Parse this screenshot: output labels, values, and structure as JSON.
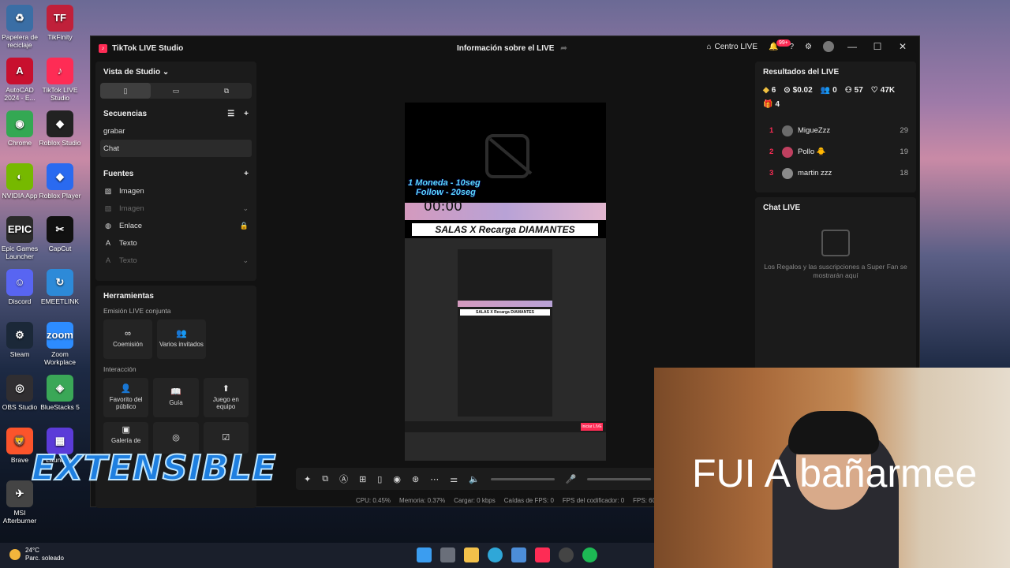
{
  "desktop_icons": [
    {
      "label": "Papelera de reciclaje",
      "icon": "recycle-bin-icon",
      "color": "#3a6ea5",
      "glyph": "♻"
    },
    {
      "label": "TikFinity",
      "icon": "tikfinity-icon",
      "color": "#c0203a",
      "glyph": "TF"
    },
    {
      "label": "AutoCAD 2024 - E...",
      "icon": "autocad-icon",
      "color": "#c8102e",
      "glyph": "A"
    },
    {
      "label": "TikTok LIVE Studio",
      "icon": "tiktok-live-icon",
      "color": "#fe2c55",
      "glyph": "♪"
    },
    {
      "label": "Chrome",
      "icon": "chrome-icon",
      "color": "#34a853",
      "glyph": "◉"
    },
    {
      "label": "Roblox Studio",
      "icon": "roblox-studio-icon",
      "color": "#222222",
      "glyph": "◆"
    },
    {
      "label": "NVIDIA App",
      "icon": "nvidia-icon",
      "color": "#76b900",
      "glyph": "◐"
    },
    {
      "label": "Roblox Player",
      "icon": "roblox-player-icon",
      "color": "#2a6af0",
      "glyph": "◆"
    },
    {
      "label": "Epic Games Launcher",
      "icon": "epic-games-icon",
      "color": "#2a2a2a",
      "glyph": "EPIC"
    },
    {
      "label": "CapCut",
      "icon": "capcut-icon",
      "color": "#111111",
      "glyph": "✂"
    },
    {
      "label": "Discord",
      "icon": "discord-icon",
      "color": "#5865f2",
      "glyph": "☺"
    },
    {
      "label": "EMEETLINK",
      "icon": "emeetlink-icon",
      "color": "#2d8ad8",
      "glyph": "↻"
    },
    {
      "label": "Steam",
      "icon": "steam-icon",
      "color": "#1b2838",
      "glyph": "⚙"
    },
    {
      "label": "Zoom Workplace",
      "icon": "zoom-icon",
      "color": "#2d8cff",
      "glyph": "zoom"
    },
    {
      "label": "OBS Studio",
      "icon": "obs-icon",
      "color": "#302e31",
      "glyph": "◎"
    },
    {
      "label": "BlueStacks 5",
      "icon": "bluestacks-icon",
      "color": "#3aa757",
      "glyph": "◈"
    },
    {
      "label": "Brave",
      "icon": "brave-icon",
      "color": "#fb542b",
      "glyph": "🦁"
    },
    {
      "label": "Launcher",
      "icon": "launcher-icon",
      "color": "#5b3bd8",
      "glyph": "▦"
    },
    {
      "label": "MSI Afterburner",
      "icon": "msi-afterburner-icon",
      "color": "#444444",
      "glyph": "✈"
    }
  ],
  "window": {
    "app_title": "TikTok LIVE Studio",
    "center_title": "Información sobre el LIVE",
    "centro_live": "Centro LIVE",
    "notif_badge": "99+"
  },
  "left": {
    "studio_view": "Vista de Studio",
    "sequences_title": "Secuencias",
    "sequences": [
      "grabar",
      "Chat"
    ],
    "sources_title": "Fuentes",
    "sources": [
      {
        "label": "Imagen",
        "dim": false,
        "tail": ""
      },
      {
        "label": "Imagen",
        "dim": true,
        "tail": "⌄"
      },
      {
        "label": "Enlace",
        "dim": false,
        "tail": "🔒"
      },
      {
        "label": "Texto",
        "dim": false,
        "tail": ""
      },
      {
        "label": "Texto",
        "dim": true,
        "tail": "⌄"
      }
    ]
  },
  "tools": {
    "title": "Herramientas",
    "group1": "Emisión LIVE conjunta",
    "group1_items": [
      "Coemisión",
      "Varios invitados"
    ],
    "group2": "Interacción",
    "group2_items": [
      "Favorito del público",
      "Guía",
      "Juego en equipo"
    ],
    "gallery": "Galería de"
  },
  "preview": {
    "promo_line1": "1 Moneda - 10seg",
    "promo_line2": "Follow - 20seg",
    "timer": "00:00",
    "banner": "SALAS X Recarga DIAMANTES",
    "nested_live": "Iniciar LIVE"
  },
  "stats": {
    "cpu": "CPU: 0.45%",
    "memoria": "Memoria: 0.37%",
    "cargar": "Cargar: 0 kbps",
    "caidas": "Caídas de FPS: 0",
    "fps_cod": "FPS del codificador: 0",
    "fps": "FPS: 60"
  },
  "results": {
    "title": "Resultados del LIVE",
    "m1": "6",
    "m2": "$0.02",
    "m3": "0",
    "m4": "57",
    "m5": "47K",
    "m6": "4",
    "ranking": [
      {
        "pos": "1",
        "name": "MigueZzz",
        "score": "29"
      },
      {
        "pos": "2",
        "name": "Pollo 🐥",
        "score": "19"
      },
      {
        "pos": "3",
        "name": "martin zzz",
        "score": "18"
      }
    ]
  },
  "chat": {
    "title": "Chat LIVE",
    "empty_text": "Los Regalos y las suscripciones a Super Fan se mostrarán aquí"
  },
  "overlay": {
    "logo_text": "EXTENSIBLE",
    "webcam_text": "FUI A bañarmee"
  },
  "taskbar": {
    "temp": "24°C",
    "weather": "Parc. soleado"
  }
}
